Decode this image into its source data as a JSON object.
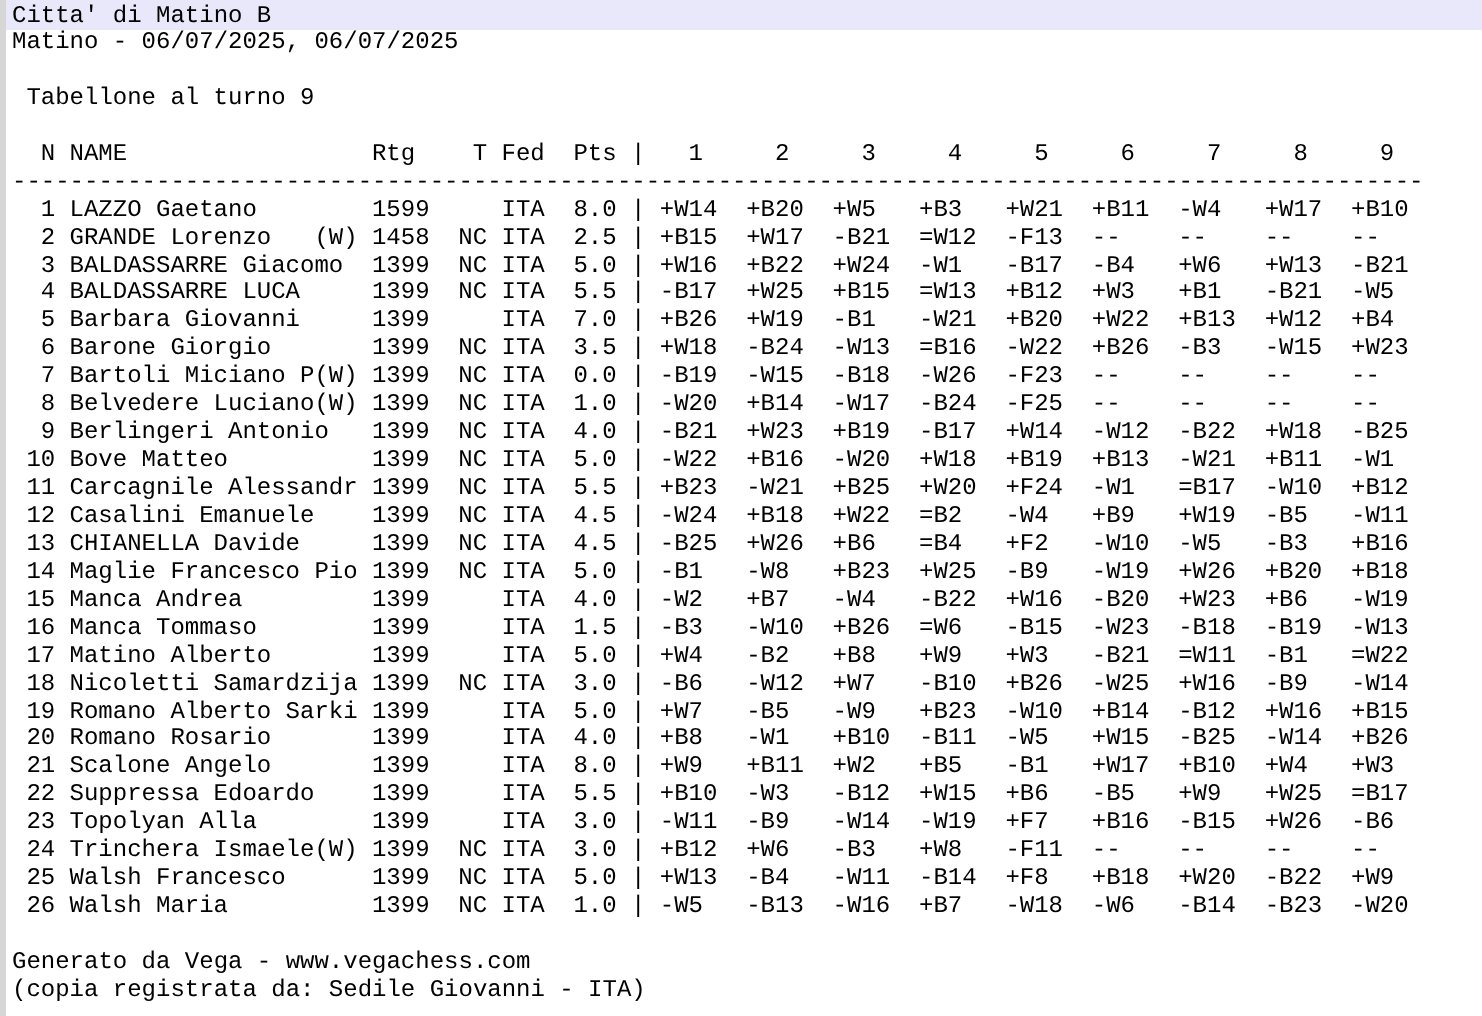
{
  "title": "Citta' di Matino B",
  "subtitle": "Matino - 06/07/2025, 06/07/2025",
  "heading": "Tabellone al turno 9",
  "columns": {
    "n": "N",
    "name": "NAME",
    "rtg": "Rtg",
    "t": "T",
    "fed": "Fed",
    "pts": "Pts",
    "sep": "|",
    "rounds": [
      "1",
      "2",
      "3",
      "4",
      "5",
      "6",
      "7",
      "8",
      "9"
    ]
  },
  "rule": "--------------------------------------------------------------------------------------------------",
  "rows": [
    {
      "n": "1",
      "name": "LAZZO Gaetano",
      "rtg": "1599",
      "fed": "ITA",
      "pts": "8.0",
      "sep": "|",
      "results": [
        "+W14",
        "+B20",
        "+W5",
        "+B3",
        "+W21",
        "+B11",
        "-W4",
        "+W17",
        "+B10"
      ]
    },
    {
      "n": "2",
      "name": "GRANDE Lorenzo   (W)",
      "rtg": "1458",
      "t": "NC",
      "fed": "ITA",
      "pts": "2.5",
      "sep": "|",
      "results": [
        "+B15",
        "+W17",
        "-B21",
        "=W12",
        "-F13",
        "--",
        "--",
        "--",
        "--"
      ]
    },
    {
      "n": "3",
      "name": "BALDASSARRE Giacomo",
      "rtg": "1399",
      "t": "NC",
      "fed": "ITA",
      "pts": "5.0",
      "sep": "|",
      "results": [
        "+W16",
        "+B22",
        "+W24",
        "-W1",
        "-B17",
        "-B4",
        "+W6",
        "+W13",
        "-B21"
      ]
    },
    {
      "n": "4",
      "name": "BALDASSARRE LUCA",
      "rtg": "1399",
      "t": "NC",
      "fed": "ITA",
      "pts": "5.5",
      "sep": "|",
      "results": [
        "-B17",
        "+W25",
        "+B15",
        "=W13",
        "+B12",
        "+W3",
        "+B1",
        "-B21",
        "-W5"
      ]
    },
    {
      "n": "5",
      "name": "Barbara Giovanni",
      "rtg": "1399",
      "fed": "ITA",
      "pts": "7.0",
      "sep": "|",
      "results": [
        "+B26",
        "+W19",
        "-B1",
        "-W21",
        "+B20",
        "+W22",
        "+B13",
        "+W12",
        "+B4"
      ]
    },
    {
      "n": "6",
      "name": "Barone Giorgio",
      "rtg": "1399",
      "t": "NC",
      "fed": "ITA",
      "pts": "3.5",
      "sep": "|",
      "results": [
        "+W18",
        "-B24",
        "-W13",
        "=B16",
        "-W22",
        "+B26",
        "-B3",
        "-W15",
        "+W23"
      ]
    },
    {
      "n": "7",
      "name": "Bartoli Miciano P(W)",
      "rtg": "1399",
      "t": "NC",
      "fed": "ITA",
      "pts": "0.0",
      "sep": "|",
      "results": [
        "-B19",
        "-W15",
        "-B18",
        "-W26",
        "-F23",
        "--",
        "--",
        "--",
        "--"
      ]
    },
    {
      "n": "8",
      "name": "Belvedere Luciano(W)",
      "rtg": "1399",
      "t": "NC",
      "fed": "ITA",
      "pts": "1.0",
      "sep": "|",
      "results": [
        "-W20",
        "+B14",
        "-W17",
        "-B24",
        "-F25",
        "--",
        "--",
        "--",
        "--"
      ]
    },
    {
      "n": "9",
      "name": "Berlingeri Antonio",
      "rtg": "1399",
      "t": "NC",
      "fed": "ITA",
      "pts": "4.0",
      "sep": "|",
      "results": [
        "-B21",
        "+W23",
        "+B19",
        "-B17",
        "+W14",
        "-W12",
        "-B22",
        "+W18",
        "-B25"
      ]
    },
    {
      "n": "10",
      "name": "Bove Matteo",
      "rtg": "1399",
      "t": "NC",
      "fed": "ITA",
      "pts": "5.0",
      "sep": "|",
      "results": [
        "-W22",
        "+B16",
        "-W20",
        "+W18",
        "+B19",
        "+B13",
        "-W21",
        "+B11",
        "-W1"
      ]
    },
    {
      "n": "11",
      "name": "Carcagnile Alessandr",
      "rtg": "1399",
      "t": "NC",
      "fed": "ITA",
      "pts": "5.5",
      "sep": "|",
      "results": [
        "+B23",
        "-W21",
        "+B25",
        "+W20",
        "+F24",
        "-W1",
        "=B17",
        "-W10",
        "+B12"
      ]
    },
    {
      "n": "12",
      "name": "Casalini Emanuele",
      "rtg": "1399",
      "t": "NC",
      "fed": "ITA",
      "pts": "4.5",
      "sep": "|",
      "results": [
        "-W24",
        "+B18",
        "+W22",
        "=B2",
        "-W4",
        "+B9",
        "+W19",
        "-B5",
        "-W11"
      ]
    },
    {
      "n": "13",
      "name": "CHIANELLA Davide",
      "rtg": "1399",
      "t": "NC",
      "fed": "ITA",
      "pts": "4.5",
      "sep": "|",
      "results": [
        "-B25",
        "+W26",
        "+B6",
        "=B4",
        "+F2",
        "-W10",
        "-W5",
        "-B3",
        "+B16"
      ]
    },
    {
      "n": "14",
      "name": "Maglie Francesco Pio",
      "rtg": "1399",
      "t": "NC",
      "fed": "ITA",
      "pts": "5.0",
      "sep": "|",
      "results": [
        "-B1",
        "-W8",
        "+B23",
        "+W25",
        "-B9",
        "-W19",
        "+W26",
        "+B20",
        "+B18"
      ]
    },
    {
      "n": "15",
      "name": "Manca Andrea",
      "rtg": "1399",
      "fed": "ITA",
      "pts": "4.0",
      "sep": "|",
      "results": [
        "-W2",
        "+B7",
        "-W4",
        "-B22",
        "+W16",
        "-B20",
        "+W23",
        "+B6",
        "-W19"
      ]
    },
    {
      "n": "16",
      "name": "Manca Tommaso",
      "rtg": "1399",
      "fed": "ITA",
      "pts": "1.5",
      "sep": "|",
      "results": [
        "-B3",
        "-W10",
        "+B26",
        "=W6",
        "-B15",
        "-W23",
        "-B18",
        "-B19",
        "-W13"
      ]
    },
    {
      "n": "17",
      "name": "Matino Alberto",
      "rtg": "1399",
      "fed": "ITA",
      "pts": "5.0",
      "sep": "|",
      "results": [
        "+W4",
        "-B2",
        "+B8",
        "+W9",
        "+W3",
        "-B21",
        "=W11",
        "-B1",
        "=W22"
      ]
    },
    {
      "n": "18",
      "name": "Nicoletti Samardzija",
      "rtg": "1399",
      "t": "NC",
      "fed": "ITA",
      "pts": "3.0",
      "sep": "|",
      "results": [
        "-B6",
        "-W12",
        "+W7",
        "-B10",
        "+B26",
        "-W25",
        "+W16",
        "-B9",
        "-W14"
      ]
    },
    {
      "n": "19",
      "name": "Romano Alberto Sarki",
      "rtg": "1399",
      "fed": "ITA",
      "pts": "5.0",
      "sep": "|",
      "results": [
        "+W7",
        "-B5",
        "-W9",
        "+B23",
        "-W10",
        "+B14",
        "-B12",
        "+W16",
        "+B15"
      ]
    },
    {
      "n": "20",
      "name": "Romano Rosario",
      "rtg": "1399",
      "fed": "ITA",
      "pts": "4.0",
      "sep": "|",
      "results": [
        "+B8",
        "-W1",
        "+B10",
        "-B11",
        "-W5",
        "+W15",
        "-B25",
        "-W14",
        "+B26"
      ]
    },
    {
      "n": "21",
      "name": "Scalone Angelo",
      "rtg": "1399",
      "fed": "ITA",
      "pts": "8.0",
      "sep": "|",
      "results": [
        "+W9",
        "+B11",
        "+W2",
        "+B5",
        "-B1",
        "+W17",
        "+B10",
        "+W4",
        "+W3"
      ]
    },
    {
      "n": "22",
      "name": "Suppressa Edoardo",
      "rtg": "1399",
      "fed": "ITA",
      "pts": "5.5",
      "sep": "|",
      "results": [
        "+B10",
        "-W3",
        "-B12",
        "+W15",
        "+B6",
        "-B5",
        "+W9",
        "+W25",
        "=B17"
      ]
    },
    {
      "n": "23",
      "name": "Topolyan Alla",
      "rtg": "1399",
      "fed": "ITA",
      "pts": "3.0",
      "sep": "|",
      "results": [
        "-W11",
        "-B9",
        "-W14",
        "-W19",
        "+F7",
        "+B16",
        "-B15",
        "+W26",
        "-B6"
      ]
    },
    {
      "n": "24",
      "name": "Trinchera Ismaele(W)",
      "rtg": "1399",
      "t": "NC",
      "fed": "ITA",
      "pts": "3.0",
      "sep": "|",
      "results": [
        "+B12",
        "+W6",
        "-B3",
        "+W8",
        "-F11",
        "--",
        "--",
        "--",
        "--"
      ]
    },
    {
      "n": "25",
      "name": "Walsh Francesco",
      "rtg": "1399",
      "t": "NC",
      "fed": "ITA",
      "pts": "5.0",
      "sep": "|",
      "results": [
        "+W13",
        "-B4",
        "-W11",
        "-B14",
        "+F8",
        "+B18",
        "+W20",
        "-B22",
        "+W9"
      ]
    },
    {
      "n": "26",
      "name": "Walsh Maria",
      "rtg": "1399",
      "t": "NC",
      "fed": "ITA",
      "pts": "1.0",
      "sep": "|",
      "results": [
        "-W5",
        "-B13",
        "-W16",
        "+B7",
        "-W18",
        "-W6",
        "-B14",
        "-B23",
        "-W20"
      ]
    }
  ],
  "footer": [
    "Generato da Vega - www.vegachess.com",
    "(copia registrata da: Sedile Giovanni - ITA)"
  ]
}
